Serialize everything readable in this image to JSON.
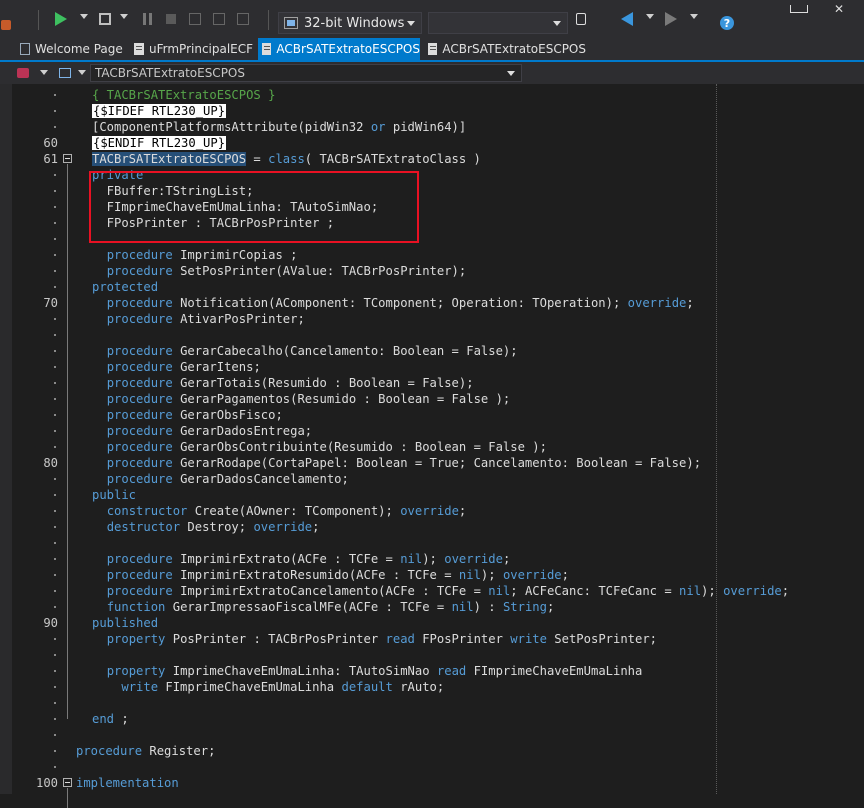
{
  "toolbar": {
    "platform": "32-bit Windows",
    "help_label": "?"
  },
  "tabs": [
    {
      "label": "Welcome Page",
      "active": false
    },
    {
      "label": "uFrmPrincipalECF",
      "active": false
    },
    {
      "label": "ACBrSATExtratoESCPOS",
      "active": true
    },
    {
      "label": "ACBrSATExtratoESCPOS",
      "active": false
    }
  ],
  "navbar": {
    "current": "TACBrSATExtratoESCPOS"
  },
  "editor": {
    "highlight_box": {
      "first_line": 6,
      "last_line": 8
    },
    "lines": [
      {
        "num": "",
        "parts": [
          {
            "t": "{ TACBrSATExtratoESCPOS }",
            "c": "cm"
          }
        ]
      },
      {
        "num": "",
        "parts": [
          {
            "t": "{$IFDEF RTL230_UP}",
            "c": "dir"
          }
        ]
      },
      {
        "num": "",
        "parts": [
          {
            "t": "[ComponentPlatformsAttribute(pidWin32 ",
            "c": "id"
          },
          {
            "t": "or",
            "c": "kw"
          },
          {
            "t": " pidWin64)]",
            "c": "id"
          }
        ]
      },
      {
        "num": "60",
        "parts": [
          {
            "t": "{$ENDIF RTL230_UP}",
            "c": "dir"
          }
        ]
      },
      {
        "num": "61",
        "fold": true,
        "parts": [
          {
            "t": "TACBrSATExtratoESCPOS",
            "c": "hl"
          },
          {
            "t": " = ",
            "c": "id"
          },
          {
            "t": "class",
            "c": "kw"
          },
          {
            "t": "( TACBrSATExtratoClass )",
            "c": "id"
          }
        ]
      },
      {
        "num": "",
        "parts": [
          {
            "t": "private",
            "c": "kw"
          }
        ]
      },
      {
        "num": "",
        "parts": [
          {
            "t": "  FBuffer:TStringList;",
            "c": "id"
          }
        ]
      },
      {
        "num": "",
        "parts": [
          {
            "t": "  FImprimeChaveEmUmaLinha: TAutoSimNao;",
            "c": "id"
          }
        ]
      },
      {
        "num": "",
        "parts": [
          {
            "t": "  FPosPrinter : TACBrPosPrinter ;",
            "c": "id"
          }
        ]
      },
      {
        "num": "",
        "parts": []
      },
      {
        "num": "",
        "parts": [
          {
            "t": "  ",
            "c": "id"
          },
          {
            "t": "procedure",
            "c": "kw"
          },
          {
            "t": " ImprimirCopias ;",
            "c": "id"
          }
        ]
      },
      {
        "num": "",
        "parts": [
          {
            "t": "  ",
            "c": "id"
          },
          {
            "t": "procedure",
            "c": "kw"
          },
          {
            "t": " SetPosPrinter(AValue: TACBrPosPrinter);",
            "c": "id"
          }
        ]
      },
      {
        "num": "",
        "parts": [
          {
            "t": "protected",
            "c": "kw"
          }
        ]
      },
      {
        "num": "70",
        "parts": [
          {
            "t": "  ",
            "c": "id"
          },
          {
            "t": "procedure",
            "c": "kw"
          },
          {
            "t": " Notification(AComponent: TComponent; Operation: TOperation); ",
            "c": "id"
          },
          {
            "t": "override",
            "c": "kw"
          },
          {
            "t": ";",
            "c": "id"
          }
        ]
      },
      {
        "num": "",
        "parts": [
          {
            "t": "  ",
            "c": "id"
          },
          {
            "t": "procedure",
            "c": "kw"
          },
          {
            "t": " AtivarPosPrinter;",
            "c": "id"
          }
        ]
      },
      {
        "num": "",
        "parts": []
      },
      {
        "num": "",
        "parts": [
          {
            "t": "  ",
            "c": "id"
          },
          {
            "t": "procedure",
            "c": "kw"
          },
          {
            "t": " GerarCabecalho(Cancelamento: Boolean = False);",
            "c": "id"
          }
        ]
      },
      {
        "num": "",
        "parts": [
          {
            "t": "  ",
            "c": "id"
          },
          {
            "t": "procedure",
            "c": "kw"
          },
          {
            "t": " GerarItens;",
            "c": "id"
          }
        ]
      },
      {
        "num": "",
        "parts": [
          {
            "t": "  ",
            "c": "id"
          },
          {
            "t": "procedure",
            "c": "kw"
          },
          {
            "t": " GerarTotais(Resumido : Boolean = False);",
            "c": "id"
          }
        ]
      },
      {
        "num": "",
        "parts": [
          {
            "t": "  ",
            "c": "id"
          },
          {
            "t": "procedure",
            "c": "kw"
          },
          {
            "t": " GerarPagamentos(Resumido : Boolean = False );",
            "c": "id"
          }
        ]
      },
      {
        "num": "",
        "parts": [
          {
            "t": "  ",
            "c": "id"
          },
          {
            "t": "procedure",
            "c": "kw"
          },
          {
            "t": " GerarObsFisco;",
            "c": "id"
          }
        ]
      },
      {
        "num": "",
        "parts": [
          {
            "t": "  ",
            "c": "id"
          },
          {
            "t": "procedure",
            "c": "kw"
          },
          {
            "t": " GerarDadosEntrega;",
            "c": "id"
          }
        ]
      },
      {
        "num": "",
        "parts": [
          {
            "t": "  ",
            "c": "id"
          },
          {
            "t": "procedure",
            "c": "kw"
          },
          {
            "t": " GerarObsContribuinte(Resumido : Boolean = False );",
            "c": "id"
          }
        ]
      },
      {
        "num": "80",
        "parts": [
          {
            "t": "  ",
            "c": "id"
          },
          {
            "t": "procedure",
            "c": "kw"
          },
          {
            "t": " GerarRodape(CortaPapel: Boolean = True; Cancelamento: Boolean = False);",
            "c": "id"
          }
        ]
      },
      {
        "num": "",
        "parts": [
          {
            "t": "  ",
            "c": "id"
          },
          {
            "t": "procedure",
            "c": "kw"
          },
          {
            "t": " GerarDadosCancelamento;",
            "c": "id"
          }
        ]
      },
      {
        "num": "",
        "parts": [
          {
            "t": "public",
            "c": "kw"
          }
        ]
      },
      {
        "num": "",
        "parts": [
          {
            "t": "  ",
            "c": "id"
          },
          {
            "t": "constructor",
            "c": "kw"
          },
          {
            "t": " Create(AOwner: TComponent); ",
            "c": "id"
          },
          {
            "t": "override",
            "c": "kw"
          },
          {
            "t": ";",
            "c": "id"
          }
        ]
      },
      {
        "num": "",
        "parts": [
          {
            "t": "  ",
            "c": "id"
          },
          {
            "t": "destructor",
            "c": "kw"
          },
          {
            "t": " Destroy; ",
            "c": "id"
          },
          {
            "t": "override",
            "c": "kw"
          },
          {
            "t": ";",
            "c": "id"
          }
        ]
      },
      {
        "num": "",
        "parts": []
      },
      {
        "num": "",
        "parts": [
          {
            "t": "  ",
            "c": "id"
          },
          {
            "t": "procedure",
            "c": "kw"
          },
          {
            "t": " ImprimirExtrato(ACFe : TCFe = ",
            "c": "id"
          },
          {
            "t": "nil",
            "c": "kw"
          },
          {
            "t": "); ",
            "c": "id"
          },
          {
            "t": "override",
            "c": "kw"
          },
          {
            "t": ";",
            "c": "id"
          }
        ]
      },
      {
        "num": "",
        "parts": [
          {
            "t": "  ",
            "c": "id"
          },
          {
            "t": "procedure",
            "c": "kw"
          },
          {
            "t": " ImprimirExtratoResumido(ACFe : TCFe = ",
            "c": "id"
          },
          {
            "t": "nil",
            "c": "kw"
          },
          {
            "t": "); ",
            "c": "id"
          },
          {
            "t": "override",
            "c": "kw"
          },
          {
            "t": ";",
            "c": "id"
          }
        ]
      },
      {
        "num": "",
        "parts": [
          {
            "t": "  ",
            "c": "id"
          },
          {
            "t": "procedure",
            "c": "kw"
          },
          {
            "t": " ImprimirExtratoCancelamento(ACFe : TCFe = ",
            "c": "id"
          },
          {
            "t": "nil",
            "c": "kw"
          },
          {
            "t": "; ACFeCanc: TCFeCanc = ",
            "c": "id"
          },
          {
            "t": "nil",
            "c": "kw"
          },
          {
            "t": "); ",
            "c": "id"
          },
          {
            "t": "override",
            "c": "kw"
          },
          {
            "t": ";",
            "c": "id"
          }
        ]
      },
      {
        "num": "",
        "parts": [
          {
            "t": "  ",
            "c": "id"
          },
          {
            "t": "function",
            "c": "kw"
          },
          {
            "t": " GerarImpressaoFiscalMFe(ACFe : TCFe = ",
            "c": "id"
          },
          {
            "t": "nil",
            "c": "kw"
          },
          {
            "t": ") : ",
            "c": "id"
          },
          {
            "t": "String",
            "c": "kw"
          },
          {
            "t": ";",
            "c": "id"
          }
        ]
      },
      {
        "num": "90",
        "parts": [
          {
            "t": "published",
            "c": "kw"
          }
        ]
      },
      {
        "num": "",
        "parts": [
          {
            "t": "  ",
            "c": "id"
          },
          {
            "t": "property",
            "c": "kw"
          },
          {
            "t": " PosPrinter : TACBrPosPrinter ",
            "c": "id"
          },
          {
            "t": "read",
            "c": "kw"
          },
          {
            "t": " FPosPrinter ",
            "c": "id"
          },
          {
            "t": "write",
            "c": "kw"
          },
          {
            "t": " SetPosPrinter;",
            "c": "id"
          }
        ]
      },
      {
        "num": "",
        "parts": []
      },
      {
        "num": "",
        "parts": [
          {
            "t": "  ",
            "c": "id"
          },
          {
            "t": "property",
            "c": "kw"
          },
          {
            "t": " ImprimeChaveEmUmaLinha: TAutoSimNao ",
            "c": "id"
          },
          {
            "t": "read",
            "c": "kw"
          },
          {
            "t": " FImprimeChaveEmUmaLinha",
            "c": "id"
          }
        ]
      },
      {
        "num": "",
        "parts": [
          {
            "t": "    ",
            "c": "id"
          },
          {
            "t": "write",
            "c": "kw"
          },
          {
            "t": " FImprimeChaveEmUmaLinha ",
            "c": "id"
          },
          {
            "t": "default",
            "c": "kw"
          },
          {
            "t": " rAuto;",
            "c": "id"
          }
        ]
      },
      {
        "num": "",
        "parts": []
      },
      {
        "num": "",
        "parts": [
          {
            "t": "end",
            "c": "kw"
          },
          {
            "t": " ;",
            "c": "id"
          }
        ]
      },
      {
        "num": "",
        "parts": []
      },
      {
        "num": "",
        "outdent": true,
        "parts": [
          {
            "t": "procedure",
            "c": "kw"
          },
          {
            "t": " Register;",
            "c": "id"
          }
        ]
      },
      {
        "num": "",
        "parts": []
      },
      {
        "num": "100",
        "fold": true,
        "outdent": true,
        "parts": [
          {
            "t": "implementation",
            "c": "kw"
          }
        ]
      }
    ]
  }
}
